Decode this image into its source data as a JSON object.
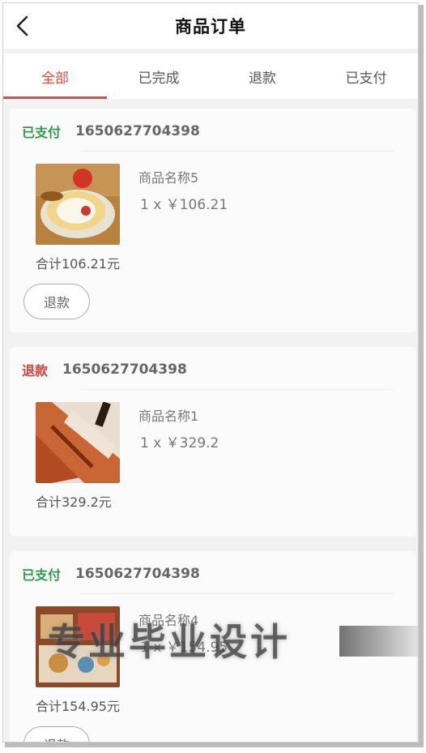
{
  "header": {
    "title": "商品订单"
  },
  "tabs": [
    {
      "label": "全部",
      "active": true
    },
    {
      "label": "已完成",
      "active": false
    },
    {
      "label": "退款",
      "active": false
    },
    {
      "label": "已支付",
      "active": false
    }
  ],
  "orders": [
    {
      "status": "已支付",
      "status_type": "paid",
      "order_no": "1650627704398",
      "item_name": "商品名称5",
      "item_qty": "1 x ￥106.21",
      "total": "合计106.21元",
      "action_label": "退款",
      "image_icon": "cake-roll-photo"
    },
    {
      "status": "退款",
      "status_type": "refund",
      "order_no": "1650627704398",
      "item_name": "商品名称1",
      "item_qty": "1 x ￥329.2",
      "total": "合计329.2元",
      "action_label": "",
      "image_icon": "grilled-meat-photo"
    },
    {
      "status": "已支付",
      "status_type": "paid",
      "order_no": "1650627704398",
      "item_name": "商品名称4",
      "item_qty": "1 x ￥154.95",
      "total": "合计154.95元",
      "action_label": "退款",
      "image_icon": "pastry-box-photo"
    }
  ],
  "watermark": {
    "text": "专业毕业设计"
  },
  "colors": {
    "accent": "#e34a3a",
    "paid": "#2e9a4a",
    "refund": "#d7433a"
  }
}
